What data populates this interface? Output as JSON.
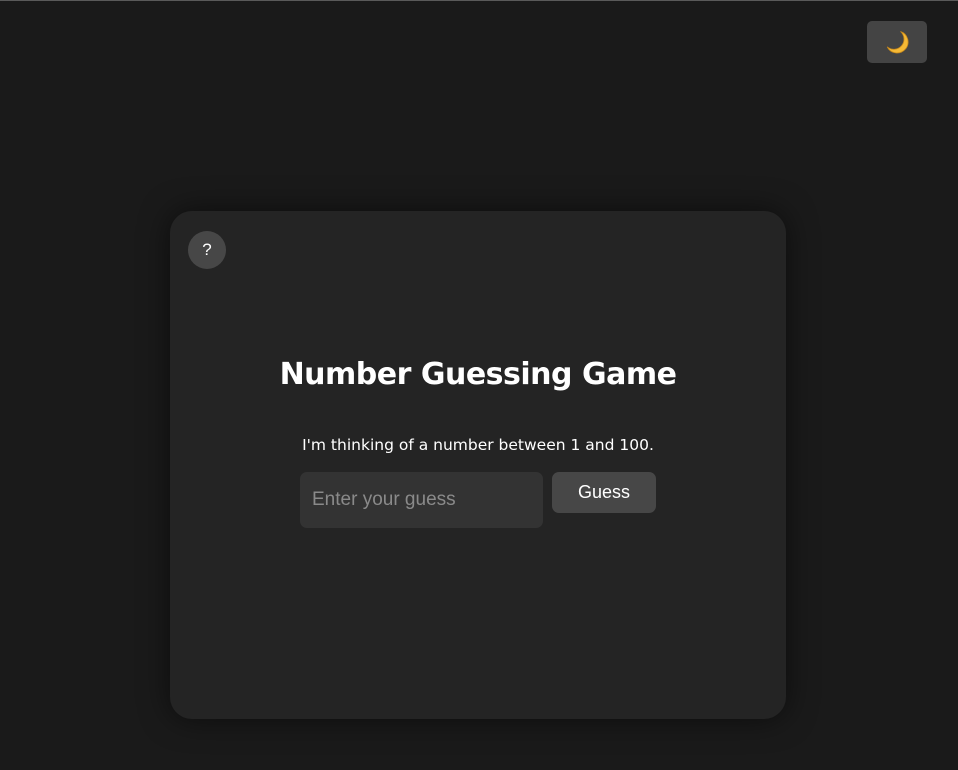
{
  "theme_toggle": {
    "icon": "moon-icon",
    "icon_color": "#f5b935"
  },
  "help": {
    "label": "?"
  },
  "game": {
    "title": "Number Guessing Game",
    "instruction": "I'm thinking of a number between 1 and 100.",
    "input_placeholder": "Enter your guess",
    "input_value": "",
    "guess_label": "Guess"
  },
  "colors": {
    "page_background": "#1a1a1a",
    "card_background": "#242424",
    "button_background": "#474747",
    "input_background": "#333333",
    "text": "#ffffff"
  }
}
